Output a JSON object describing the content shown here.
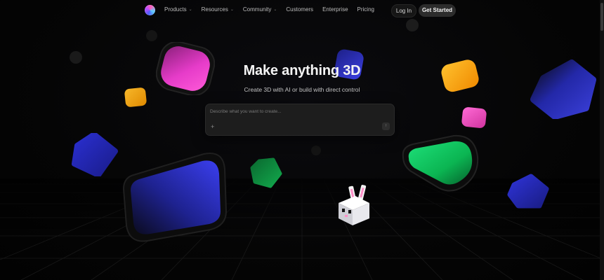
{
  "nav": {
    "items": [
      {
        "label": "Products",
        "has_dropdown": true
      },
      {
        "label": "Resources",
        "has_dropdown": true
      },
      {
        "label": "Community",
        "has_dropdown": true
      },
      {
        "label": "Customers",
        "has_dropdown": false
      },
      {
        "label": "Enterprise",
        "has_dropdown": false
      },
      {
        "label": "Pricing",
        "has_dropdown": false
      }
    ],
    "login_label": "Log In",
    "cta_label": "Get Started"
  },
  "hero": {
    "title": "Make anything 3D",
    "subtitle": "Create 3D with AI or build with direct control"
  },
  "prompt": {
    "placeholder": "Describe what you want to create...",
    "value": "",
    "add_glyph": "+",
    "send_glyph": "↑"
  },
  "icons": {
    "logo": "gradient-orb-logo",
    "add": "plus-icon",
    "send": "arrow-up-icon",
    "dropdown": "chevron-down-icon"
  },
  "colors": {
    "background": "#050505",
    "pink": "#e63cc9",
    "blue": "#2a2fd0",
    "orange": "#f5a20a",
    "green": "#10c05a",
    "cta_bg": "#2c2c2c"
  }
}
